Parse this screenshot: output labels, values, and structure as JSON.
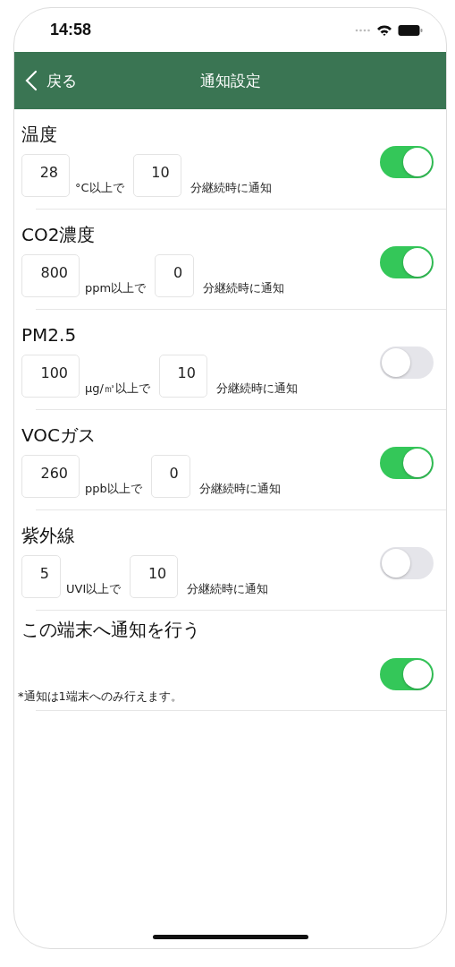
{
  "status_bar": {
    "time": "14:58"
  },
  "nav": {
    "back": "戻る",
    "title": "通知設定"
  },
  "settings": [
    {
      "kind": "threshold",
      "title": "温度",
      "threshold": "28",
      "unit": "°C以上で",
      "duration": "10",
      "suffix": "分継続時に通知",
      "on": true
    },
    {
      "kind": "threshold",
      "title": "CO2濃度",
      "threshold": "800",
      "unit": "ppm以上で",
      "duration": "0",
      "suffix": "分継続時に通知",
      "on": true
    },
    {
      "kind": "threshold",
      "title": "PM2.5",
      "threshold": "100",
      "unit": "μg/㎥以上で",
      "duration": "10",
      "suffix": "分継続時に通知",
      "on": false
    },
    {
      "kind": "threshold",
      "title": "VOCガス",
      "threshold": "260",
      "unit": "ppb以上で",
      "duration": "0",
      "suffix": "分継続時に通知",
      "on": true
    },
    {
      "kind": "threshold",
      "title": "紫外線",
      "threshold": "5",
      "unit": "UVI以上で",
      "duration": "10",
      "suffix": "分継続時に通知",
      "on": false
    },
    {
      "kind": "device",
      "title": "この端末へ通知を行う",
      "note": "*通知は1端末へのみ行えます。",
      "on": true
    }
  ]
}
